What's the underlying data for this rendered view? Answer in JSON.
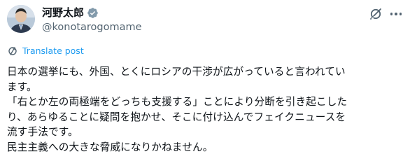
{
  "author": {
    "display_name": "河野太郎",
    "handle": "@konotarogomame",
    "verified": true,
    "verified_badge_color": "#829aab"
  },
  "actions": {
    "grok_icon": "grok-icon",
    "more_icon": "more-icon"
  },
  "translate": {
    "label": "Translate post",
    "color": "#1d9bf0"
  },
  "post": {
    "lines": [
      "日本の選挙にも、外国、とくにロシアの干渉が広がっていると言われてい",
      "ます。",
      "「右とか左の両極端をどっちも支援する」ことにより分断を引き起こした",
      "り、あらゆることに疑問を抱かせ、そこに付け込んでフェイクニュースを",
      "流す手法です。",
      "民主主義への大きな脅威になりかねません。"
    ]
  }
}
